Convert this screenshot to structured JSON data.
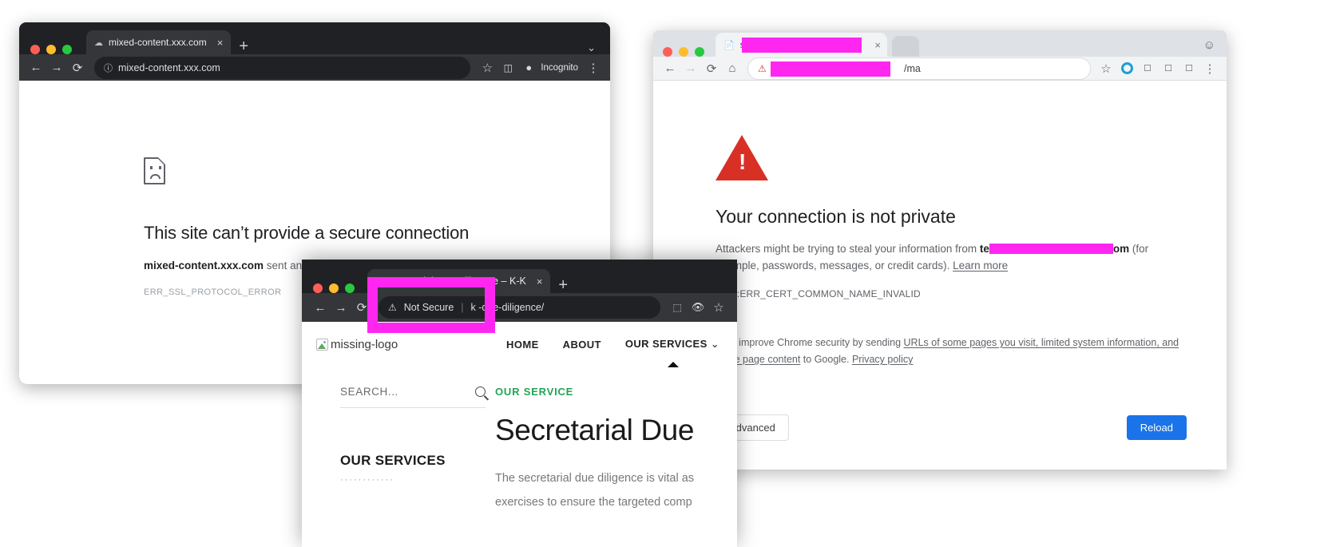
{
  "window1": {
    "tab": {
      "title": "mixed-content.xxx.com",
      "close": "×",
      "favicon": "globe-icon"
    },
    "newtab": "+",
    "nav": {
      "back": "←",
      "forward": "→",
      "reload": "⟳",
      "chevron": "⌄"
    },
    "omnibox": {
      "info_icon": "ⓘ",
      "url": "mixed-content.xxx.com"
    },
    "toolbar": {
      "star": "☆",
      "sidepanel": "◫",
      "incognito_label": "Incognito",
      "menu": "⋮"
    },
    "page": {
      "heading": "This site can’t provide a secure connection",
      "detail_host": "mixed-content.xxx.com",
      "detail_rest": " sent an invalid response.",
      "error_code": "ERR_SSL_PROTOCOL_ERROR"
    }
  },
  "window2": {
    "tab": {
      "title_prefix": "s",
      "close": "×",
      "favicon": "page-icon",
      "redacted": true
    },
    "nav": {
      "back": "←",
      "forward": "→",
      "reload": "⟳",
      "home": "⌂"
    },
    "omnibox": {
      "warn_icon": "⚠",
      "url_suffix": "/ma",
      "redacted": true
    },
    "toolbar": {
      "star": "☆",
      "extension": "blue-dot-icon",
      "profile": "person-icon",
      "menu": "⋮"
    },
    "page": {
      "heading": "Your connection is not private",
      "body_pre": "Attackers might be trying to steal your information from ",
      "body_host_start": "te",
      "body_host_end": "om",
      "body_mid": " (for example, passwords, messages, or credit cards). ",
      "learn_more": "Learn more",
      "error_code": "NET::ERR_CERT_COMMON_NAME_INVALID",
      "improve_pre": "Help improve Chrome security by sending ",
      "improve_link1": "URLs of some pages you visit, limited system information, and some page content",
      "improve_mid": " to Google. ",
      "improve_link2": "Privacy policy",
      "advanced_button": "Advanced",
      "reload_button": "Reload"
    }
  },
  "window3": {
    "tab": {
      "title": "Secretarial Due Diligence – K-K",
      "close": "×",
      "favicon": "site-icon"
    },
    "newtab": "+",
    "nav": {
      "back": "←",
      "forward": "→",
      "reload": "⟳"
    },
    "omnibox": {
      "warn_icon": "⚠",
      "not_secure_label": "Not Secure",
      "divider": "|",
      "url": "k           -due-diligence/"
    },
    "toolbar": {
      "qr": "⬚",
      "hide": "eye-slash-icon",
      "star": "☆"
    },
    "site": {
      "logo_alt": "missing-logo",
      "nav": [
        "HOME",
        "ABOUT",
        "OUR SERVICES"
      ],
      "search_placeholder": "SEARCH...",
      "sidebar_heading": "OUR SERVICES",
      "sidebar_dots": "············",
      "eyebrow": "OUR SERVICE",
      "title": "Secretarial Due",
      "paragraph_line1": "The secretarial due diligence is vital as",
      "paragraph_line2": "exercises to ensure the targeted comp"
    }
  },
  "colors": {
    "redaction": "#ff27f0",
    "danger_red": "#d93025",
    "accent_blue": "#1a73e8",
    "site_green": "#23a455"
  }
}
